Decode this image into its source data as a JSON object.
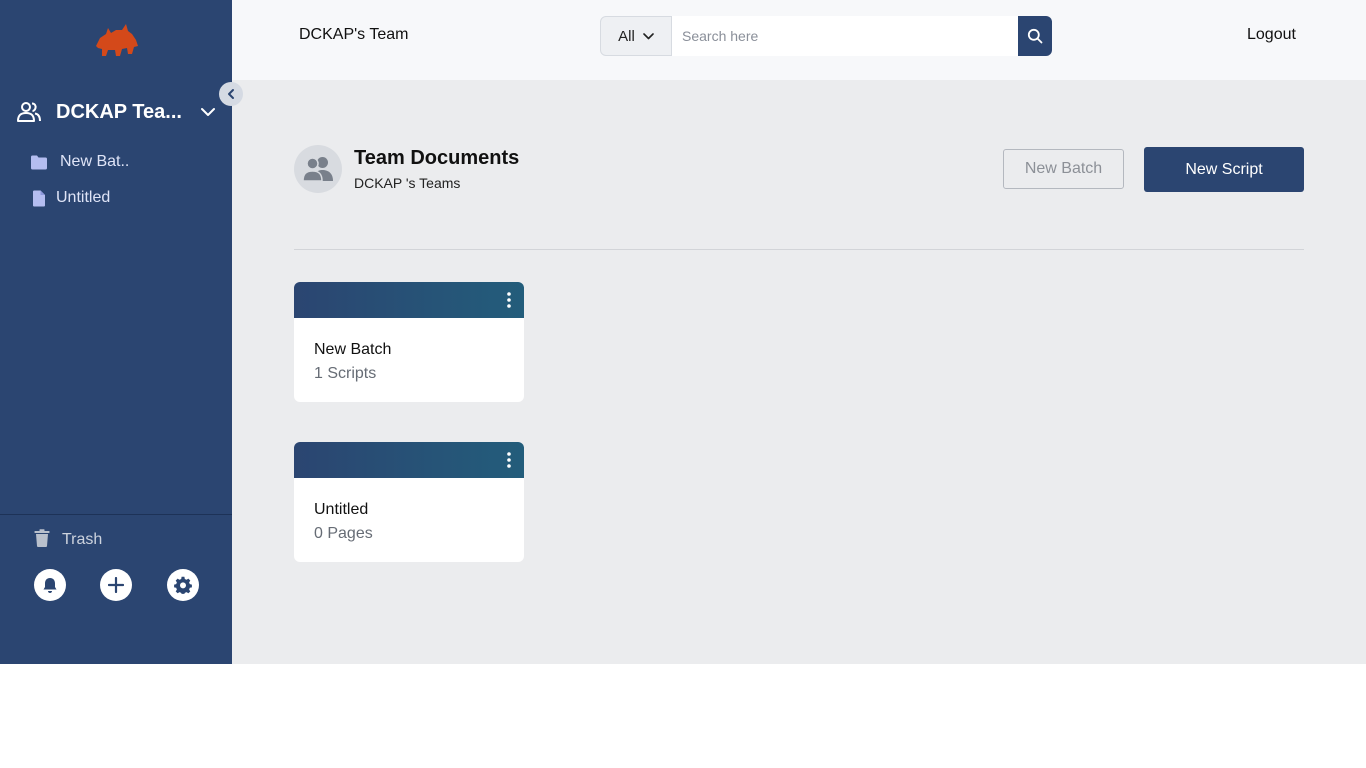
{
  "sidebar": {
    "team_name": "DCKAP Tea...",
    "items": [
      {
        "label": "New Bat..",
        "icon": "folder-icon"
      },
      {
        "label": "Untitled",
        "icon": "document-icon"
      }
    ],
    "trash_label": "Trash",
    "footer_icons": [
      "bell-icon",
      "plus-icon",
      "gear-icon"
    ],
    "colors": {
      "background": "#2b4571",
      "logo": "#d4491a"
    }
  },
  "header": {
    "title": "DCKAP's Team",
    "search": {
      "filter": "All",
      "placeholder": "Search here"
    },
    "logout_label": "Logout"
  },
  "main": {
    "title": "Team Documents",
    "subtitle": "DCKAP 's Teams",
    "new_batch_label": "New Batch",
    "new_script_label": "New Script",
    "cards": [
      {
        "title": "New Batch",
        "count": "1 Scripts"
      },
      {
        "title": "Untitled",
        "count": "0 Pages"
      }
    ]
  }
}
